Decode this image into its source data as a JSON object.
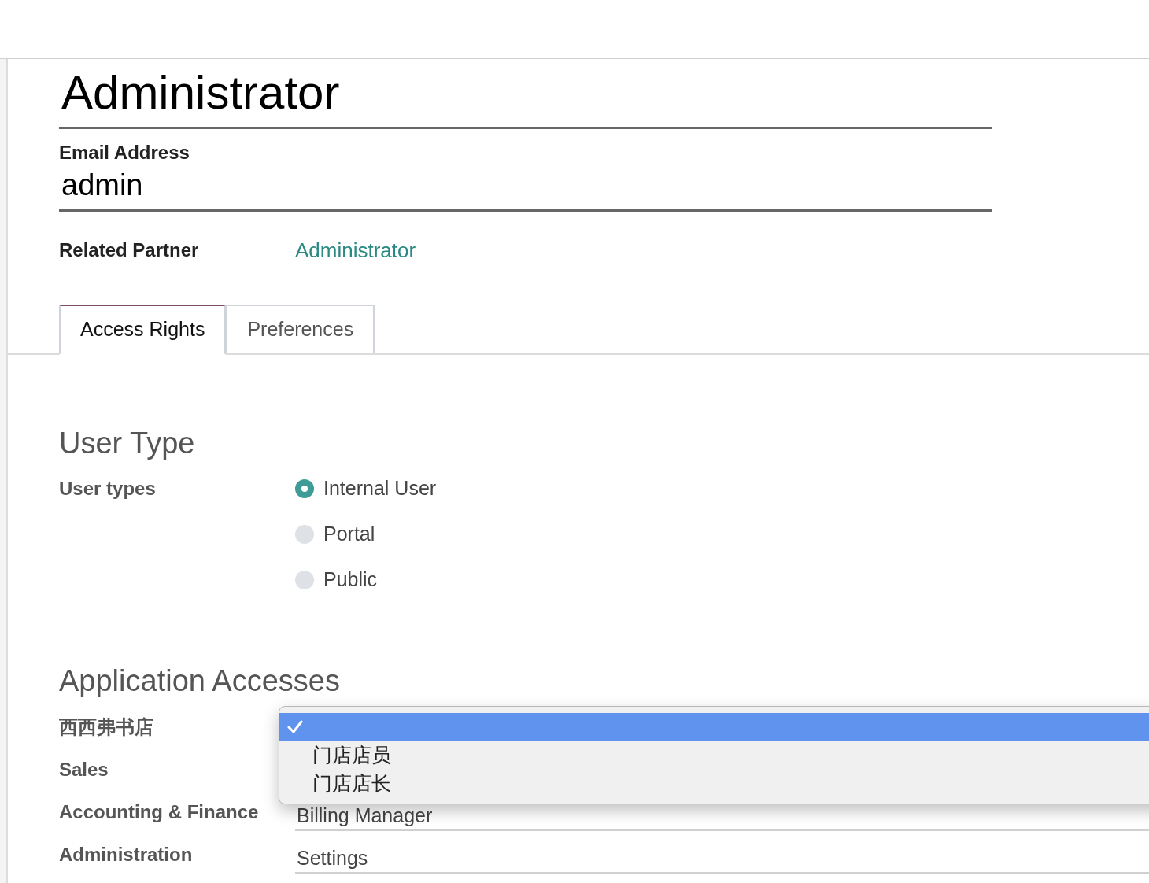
{
  "record": {
    "name": "Administrator",
    "email_label": "Email Address",
    "email_value": "admin"
  },
  "related_partner": {
    "label": "Related Partner",
    "value": "Administrator"
  },
  "tabs": [
    {
      "label": "Access Rights",
      "selected": true
    },
    {
      "label": "Preferences",
      "selected": false
    }
  ],
  "user_type": {
    "heading": "User Type",
    "label": "User types",
    "options": [
      {
        "label": "Internal User",
        "selected": true
      },
      {
        "label": "Portal",
        "selected": false
      },
      {
        "label": "Public",
        "selected": false
      }
    ]
  },
  "application_accesses": {
    "heading": "Application Accesses",
    "rows": [
      {
        "label": "西西弗书店"
      },
      {
        "label": "Sales"
      },
      {
        "label": "Accounting & Finance",
        "value": "Billing Manager"
      },
      {
        "label": "Administration",
        "value": "Settings"
      }
    ]
  },
  "dropdown_menu": {
    "options": [
      {
        "selected": true
      },
      {
        "label": "门店店员",
        "selected": false
      },
      {
        "label": "门店店长",
        "selected": false
      }
    ]
  }
}
